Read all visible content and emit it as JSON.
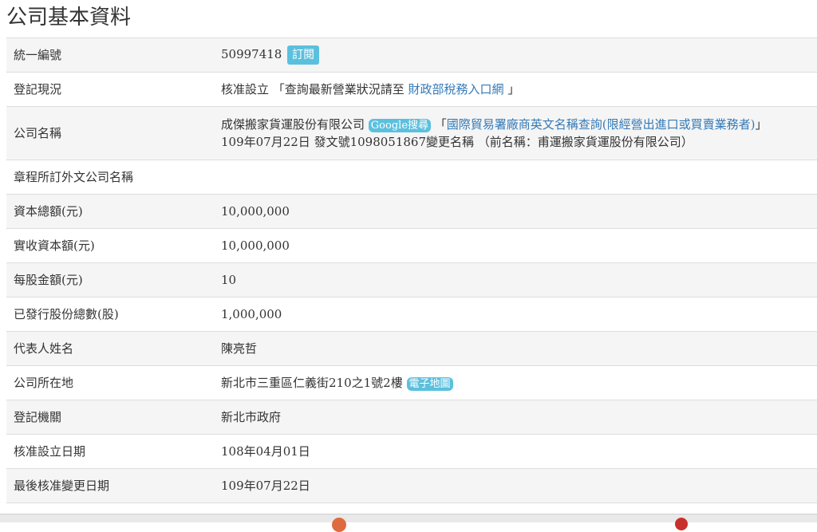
{
  "page_title": "公司基本資料",
  "rows": {
    "tax_id": {
      "label": "統一編號",
      "value": "50997418",
      "button": "訂閱"
    },
    "status": {
      "label": "登記現況",
      "prefix": "核准設立 「查詢最新營業狀況請至 ",
      "link": "財政部稅務入口網",
      "suffix": " 」"
    },
    "company_name": {
      "label": "公司名稱",
      "name": "成傑搬家貨運股份有限公司",
      "badge": "Google搜尋",
      "link_prefix": " 「",
      "link": "國際貿易署廠商英文名稱查詢(限經營出進口或買賣業務者)",
      "link_suffix": "」",
      "history": "109年07月22日 發文號1098051867變更名稱 （前名稱：甫運搬家貨運股份有限公司）"
    },
    "foreign_name": {
      "label": "章程所訂外文公司名稱",
      "value": ""
    },
    "capital_total": {
      "label": "資本總額(元)",
      "value": "10,000,000"
    },
    "capital_paid": {
      "label": "實收資本額(元)",
      "value": "10,000,000"
    },
    "share_value": {
      "label": "每股金額(元)",
      "value": "10"
    },
    "shares_issued": {
      "label": "已發行股份總數(股)",
      "value": "1,000,000"
    },
    "representative": {
      "label": "代表人姓名",
      "value": "陳亮哲"
    },
    "address": {
      "label": "公司所在地",
      "value": "新北市三重區仁義街210之1號2樓",
      "badge": "電子地圖"
    },
    "authority": {
      "label": "登記機關",
      "value": "新北市政府"
    },
    "approval_date": {
      "label": "核准設立日期",
      "value": "108年04月01日"
    },
    "last_change_date": {
      "label": "最後核准變更日期",
      "value": "109年07月22日"
    }
  }
}
